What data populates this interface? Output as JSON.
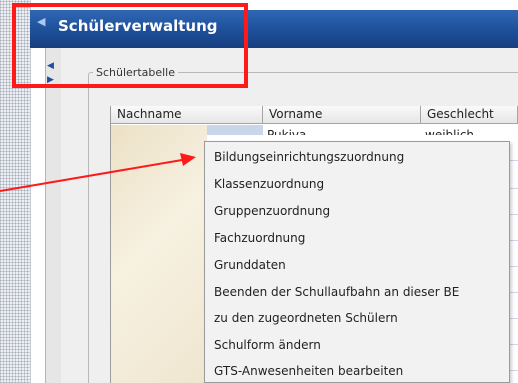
{
  "window": {
    "title": "Schülerverwaltung"
  },
  "group": {
    "title": "Schülertabelle"
  },
  "table": {
    "columns": [
      "Nachname",
      "Vorname",
      "Geschlecht"
    ],
    "first_row": {
      "vorname": "Pukiva",
      "geschlecht": "weiblich"
    }
  },
  "context_menu": {
    "items": [
      "Bildungseinrichtungszuordnung",
      "Klassenzuordnung",
      "Gruppenzuordnung",
      "Fachzuordnung",
      "Grunddaten",
      "Beenden der Schullaufbahn an dieser BE",
      "zu den zugeordneten Schülern",
      "Schulform ändern",
      "GTS-Anwesenheiten bearbeiten"
    ]
  },
  "colors": {
    "title_bar": "#1e4f99",
    "annotation": "#ff1a1a"
  },
  "icons": [
    "collapse-left-icon",
    "expand-right-icon"
  ]
}
